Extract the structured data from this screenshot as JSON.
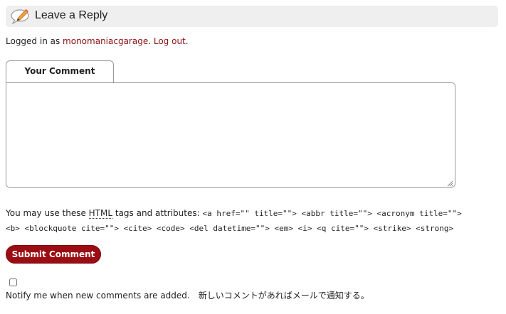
{
  "header": {
    "title": "Leave a Reply",
    "icon": "pencil-speech-bubble-icon"
  },
  "login": {
    "prefix": "Logged in as ",
    "username": "monomaniacgarage",
    "separator": ". ",
    "logout_label": "Log out",
    "suffix": "."
  },
  "comment": {
    "tab_label": "Your Comment",
    "value": ""
  },
  "allowed_tags": {
    "prefix": "You may use these ",
    "html_abbr": "HTML",
    "middle": " tags and attributes: ",
    "tags": "<a href=\"\" title=\"\"> <abbr title=\"\"> <acronym title=\"\"> <b> <blockquote cite=\"\"> <cite> <code> <del datetime=\"\"> <em> <i> <q cite=\"\"> <strike> <strong>"
  },
  "submit": {
    "label": "Submit Comment"
  },
  "notify": {
    "checked": false,
    "label": "Notify me when new comments are added.　新しいコメントがあればメールで通知する。"
  },
  "colors": {
    "accent": "#9b0d12",
    "link": "#8c1014",
    "header_bg": "#efefef"
  }
}
